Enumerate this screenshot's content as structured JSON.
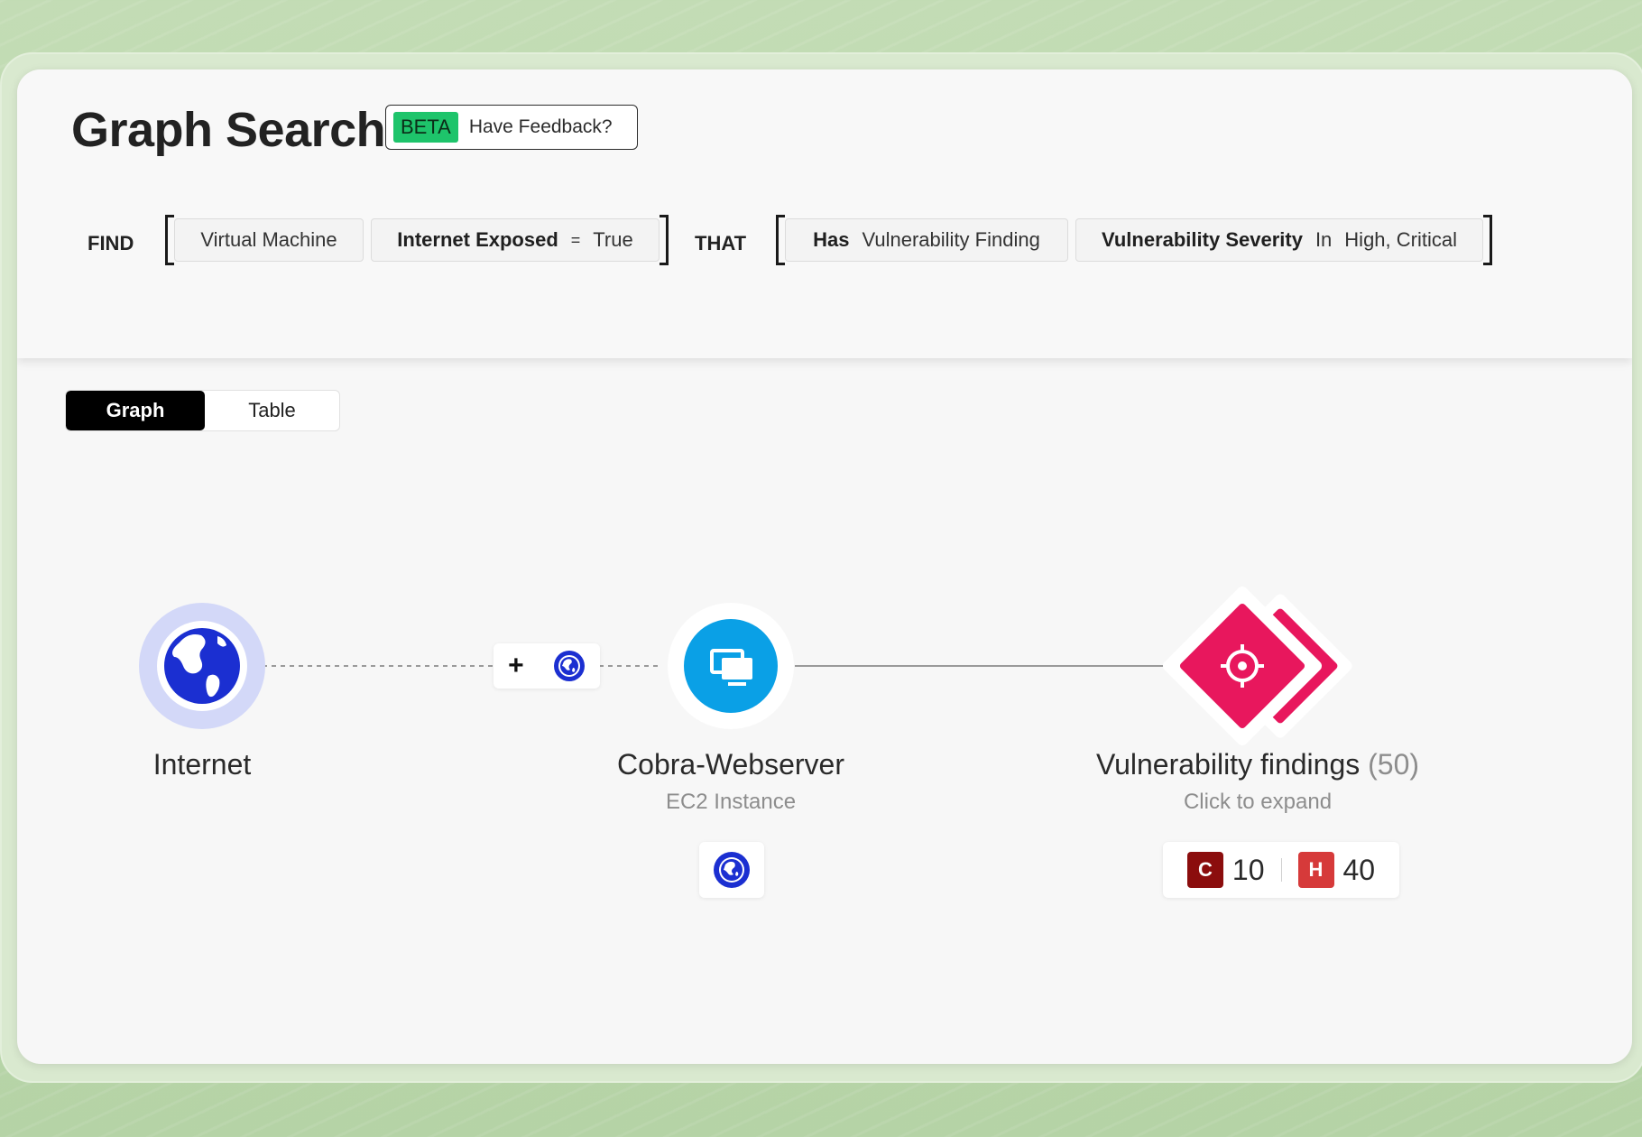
{
  "header": {
    "title": "Graph Search",
    "beta_label": "BETA",
    "feedback_label": "Have Feedback?"
  },
  "query": {
    "find_keyword": "FIND",
    "that_keyword": "THAT",
    "find_chips": [
      {
        "text": "Virtual Machine"
      },
      {
        "field": "Internet Exposed",
        "operator": "=",
        "value": "True"
      }
    ],
    "that_chips": [
      {
        "field": "Has",
        "value": "Vulnerability Finding"
      },
      {
        "field": "Vulnerability Severity",
        "operator": "In",
        "value": "High, Critical"
      }
    ]
  },
  "view_toggle": {
    "options": [
      "Graph",
      "Table"
    ],
    "selected": "Graph"
  },
  "graph": {
    "nodes": [
      {
        "id": "internet",
        "label": "Internet",
        "icon": "globe-icon"
      },
      {
        "id": "webserver",
        "label": "Cobra-Webserver",
        "sublabel": "EC2 Instance",
        "icon": "virtual-machine-icon",
        "badge_icon": "globe-icon"
      },
      {
        "id": "findings",
        "label": "Vulnerability findings",
        "count": "(50)",
        "sublabel": "Click to expand",
        "icon": "vulnerability-target-icon"
      }
    ],
    "edge_controls": {
      "expand_symbol": "+",
      "icon": "globe-icon"
    },
    "severity": [
      {
        "code": "C",
        "count": "10",
        "color": "#8b0d0d"
      },
      {
        "code": "H",
        "count": "40",
        "color": "#d63a3a"
      }
    ]
  },
  "colors": {
    "accent_pink": "#e8175d",
    "vm_blue": "#0aa0e6",
    "globe_blue": "#1b2fd1",
    "internet_halo": "#d3d8f8",
    "beta_green": "#1ec46b"
  }
}
